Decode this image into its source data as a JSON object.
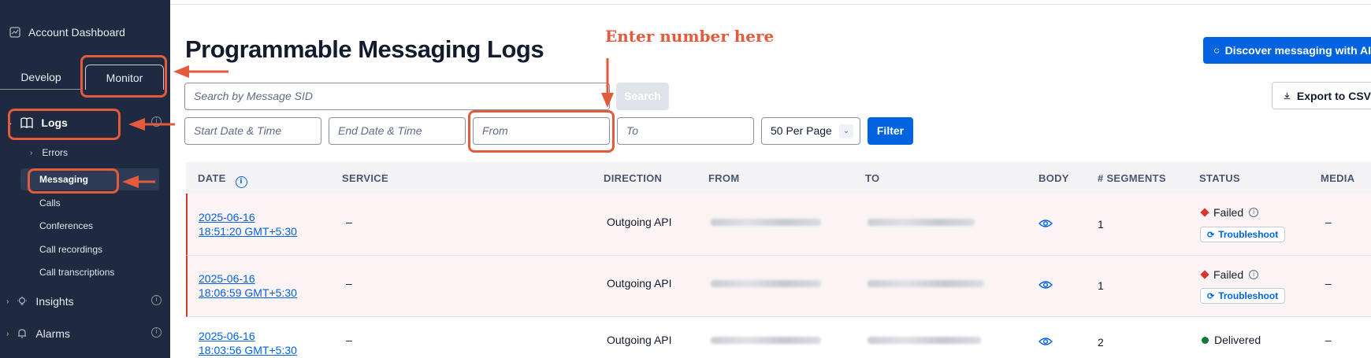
{
  "sidebar": {
    "dashboard_label": "Account Dashboard",
    "tabs": [
      {
        "label": "Develop"
      },
      {
        "label": "Monitor"
      }
    ],
    "logs_label": "Logs",
    "logs_items": [
      {
        "label": "Errors"
      },
      {
        "label": "Messaging"
      },
      {
        "label": "Calls"
      },
      {
        "label": "Conferences"
      },
      {
        "label": "Call recordings"
      },
      {
        "label": "Call transcriptions"
      }
    ],
    "sections": [
      {
        "label": "Insights"
      },
      {
        "label": "Alarms"
      }
    ]
  },
  "main": {
    "title": "Programmable Messaging Logs",
    "annotation_text": "Enter number here",
    "ai_button_label": "Discover messaging with AI",
    "export_button_label": "Export to CSV",
    "search_placeholder": "Search by Message SID",
    "search_button_label": "Search",
    "start_date_placeholder": "Start Date & Time",
    "end_date_placeholder": "End Date & Time",
    "from_placeholder": "From",
    "to_placeholder": "To",
    "per_page_value": "50 Per Page",
    "filter_button_label": "Filter"
  },
  "table": {
    "columns": [
      "DATE",
      "SERVICE",
      "DIRECTION",
      "FROM",
      "TO",
      "BODY",
      "# SEGMENTS",
      "STATUS",
      "MEDIA"
    ],
    "rows": [
      {
        "date": "2025-06-16",
        "time": "18:51:20 GMT+5:30",
        "service": "–",
        "direction": "Outgoing API",
        "segments": "1",
        "status": "Failed",
        "action": "Troubleshoot",
        "media": "–"
      },
      {
        "date": "2025-06-16",
        "time": "18:06:59 GMT+5:30",
        "service": "–",
        "direction": "Outgoing API",
        "segments": "1",
        "status": "Failed",
        "action": "Troubleshoot",
        "media": "–"
      },
      {
        "date": "2025-06-16",
        "time": "18:03:56 GMT+5:30",
        "service": "–",
        "direction": "Outgoing API",
        "segments": "2",
        "status": "Delivered",
        "media": "–"
      }
    ]
  },
  "colors": {
    "accent": "#0263e0",
    "sidebar_bg": "#1f2a40",
    "failed": "#d6372c",
    "delivered": "#14773b",
    "annotation": "#e35a3c"
  }
}
